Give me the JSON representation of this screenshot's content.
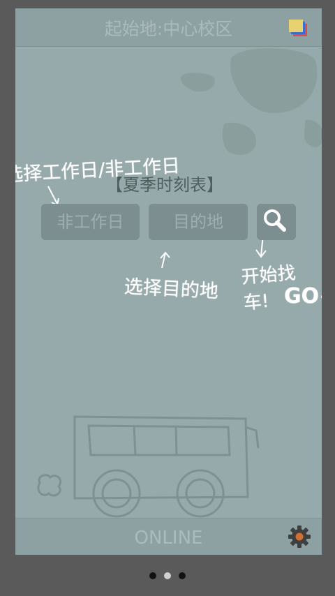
{
  "header": {
    "title": "起始地:中心校区"
  },
  "schedule": {
    "title": "【夏季时刻表】"
  },
  "controls": {
    "day_type": "非工作日",
    "destination": "目的地"
  },
  "annotations": {
    "select_day": "选择工作日/非工作日",
    "select_destination": "选择目的地",
    "find_bus": "开始找车!",
    "go": "GO~"
  },
  "footer": {
    "status": "ONLINE"
  },
  "pager": {
    "count": 3,
    "active_index": 1
  },
  "colors": {
    "app_bg": "#97aaab",
    "bar_bg": "#8ea1a2",
    "pill_bg": "#7c8e90",
    "outer_bg": "#5a5a5a"
  }
}
